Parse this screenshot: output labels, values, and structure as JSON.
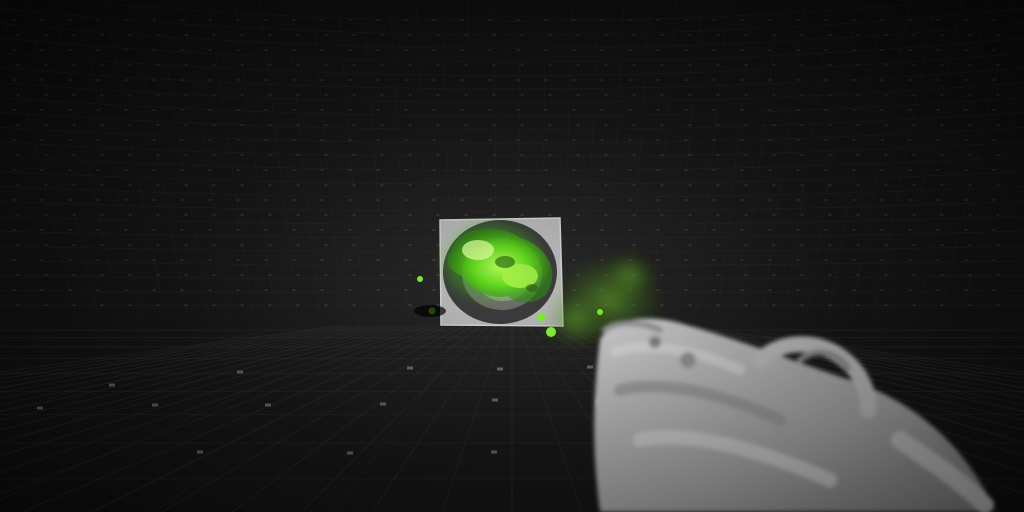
{
  "scene": {
    "environment": "grid-room",
    "colors": {
      "background": "#161616",
      "grid_line": "#3a3a3a",
      "grid_dot": "#8a8a8a",
      "floor_accent": "#5a2a22",
      "slime": "#7cff2a",
      "slime_glow": "#4fd11a",
      "target_panel": "#b9b9b9",
      "weapon": "#c8c8c8"
    },
    "objects": [
      {
        "name": "target-panel",
        "icon": "square-target"
      },
      {
        "name": "slime-blob",
        "icon": "green-goo"
      },
      {
        "name": "first-person-weapon",
        "icon": "gun"
      }
    ]
  }
}
